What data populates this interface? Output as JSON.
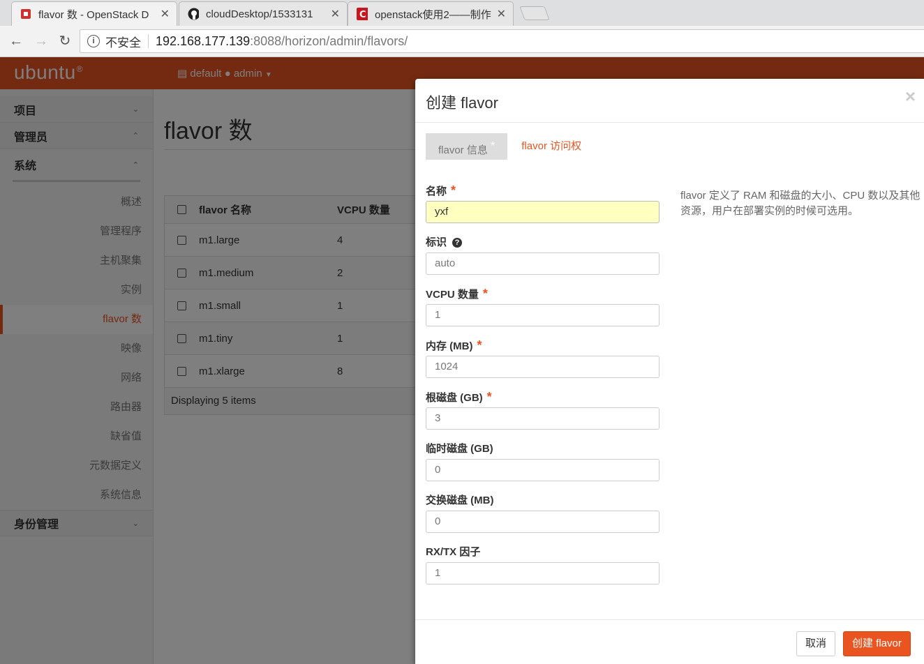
{
  "browser": {
    "tabs": [
      {
        "title": "flavor 数 - OpenStack D",
        "icon": "openstack-icon"
      },
      {
        "title": "cloudDesktop/1533131",
        "icon": "github-icon"
      },
      {
        "title": "openstack使用2——制作",
        "icon": "csdn-icon"
      }
    ],
    "security_label": "不安全",
    "url_host": "192.168.177.139",
    "url_rest": ":8088/horizon/admin/flavors/"
  },
  "header": {
    "logo": "ubuntu",
    "project": "default",
    "user": "admin"
  },
  "sidebar": {
    "panels": [
      {
        "label": "项目"
      },
      {
        "label": "管理员"
      }
    ],
    "section": "系统",
    "items": [
      "概述",
      "管理程序",
      "主机聚集",
      "实例",
      "flavor 数",
      "映像",
      "网络",
      "路由器",
      "缺省值",
      "元数据定义",
      "系统信息"
    ],
    "identity": "身份管理"
  },
  "main": {
    "title": "flavor 数",
    "columns": [
      "flavor 名称",
      "VCPU 数量"
    ],
    "rows": [
      {
        "name": "m1.large",
        "vcpu": "4"
      },
      {
        "name": "m1.medium",
        "vcpu": "2"
      },
      {
        "name": "m1.small",
        "vcpu": "1"
      },
      {
        "name": "m1.tiny",
        "vcpu": "1"
      },
      {
        "name": "m1.xlarge",
        "vcpu": "8"
      }
    ],
    "footer": "Displaying 5 items"
  },
  "modal": {
    "title": "创建 flavor",
    "close": "×",
    "tab_info": "flavor 信息",
    "tab_info_marker": "*",
    "tab_access": "flavor 访问权",
    "fields": {
      "name": {
        "label": "名称",
        "value": "yxf"
      },
      "id": {
        "label": "标识",
        "value": "auto"
      },
      "vcpu": {
        "label": "VCPU 数量",
        "value": "1"
      },
      "ram": {
        "label": "内存 (MB)",
        "value": "1024"
      },
      "disk": {
        "label": "根磁盘 (GB)",
        "value": "3"
      },
      "ephemeral": {
        "label": "临时磁盘 (GB)",
        "value": "0"
      },
      "swap": {
        "label": "交换磁盘 (MB)",
        "value": "0"
      },
      "rxtx": {
        "label": "RX/TX 因子",
        "value": "1"
      }
    },
    "help_text": "flavor 定义了 RAM 和磁盘的大小、CPU 数以及其他资源，用户在部署实例的时候可选用。",
    "cancel": "取消",
    "submit": "创建 flavor"
  },
  "colors": {
    "accent": "#e95420"
  }
}
